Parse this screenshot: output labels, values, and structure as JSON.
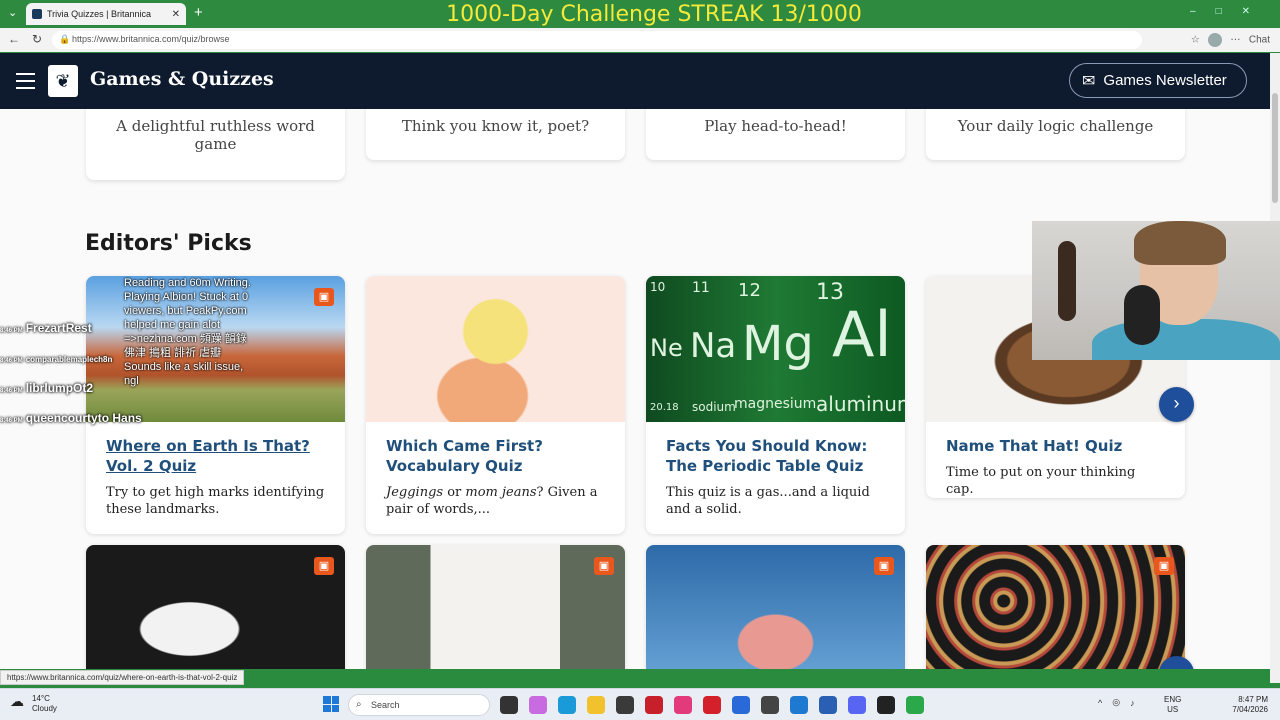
{
  "browser": {
    "tab_title": "Trivia Quizzes | Britannica",
    "url": "https://www.britannica.com/quiz/browse",
    "chat_label": "Chat",
    "status_url": "https://www.britannica.com/quiz/where-on-earth-is-that-vol-2-quiz"
  },
  "overlay": {
    "streak": "1000-Day Challenge STREAK 13/1000",
    "stream_text": "Reading and 60m Writing. Playing Albion! Stuck at 0 viewers, but PeakPy.com helped me gain alot =>nezhna.com 頻躁 韻錄 佛津 搗粗 誹祈 虐瓣 Sounds like a skill issue, ngl",
    "chat": [
      {
        "time": "8:46 PM",
        "user": "FrezartRest"
      },
      {
        "time": "8:46 PM",
        "user": "comparablemaplech8n"
      },
      {
        "time": "8:46 PM",
        "user": "librlumpOt2"
      },
      {
        "time": "8:46 PM",
        "user": "queencourtyto Hans"
      }
    ]
  },
  "header": {
    "site_title": "Games & Quizzes",
    "newsletter_label": "Games Newsletter"
  },
  "top_cards": [
    {
      "text": "A delightful ruthless word game"
    },
    {
      "text": "Think you know it, poet?"
    },
    {
      "text": "Play head-to-head!"
    },
    {
      "text": "Your daily logic challenge"
    }
  ],
  "editors_picks": {
    "title": "Editors' Picks",
    "cards": [
      {
        "title": "Where on Earth Is That? Vol. 2 Quiz",
        "desc": "Try to get high marks identifying these landmarks."
      },
      {
        "title": "Which Came First? Vocabulary Quiz",
        "desc_italic_1": "Jeggings",
        "desc_mid": " or ",
        "desc_italic_2": "mom jeans",
        "desc_rest": "? Given a pair of words,..."
      },
      {
        "title": "Facts You Should Know: The Periodic Table Quiz",
        "desc": "This quiz is a gas...and a liquid and a solid."
      },
      {
        "title": "Name That Hat! Quiz",
        "desc": "Time to put on your thinking cap."
      }
    ],
    "elements": [
      "Ne",
      "Na",
      "Mg",
      "Al"
    ],
    "element_sub": [
      "20.18",
      "sodium",
      "magnesium",
      "aluminum"
    ],
    "element_num": [
      "10",
      "11",
      "12",
      "13"
    ]
  },
  "taskbar": {
    "temp": "14°C",
    "weather": "Cloudy",
    "search_placeholder": "Search",
    "lang1": "ENG",
    "lang2": "US",
    "time": "8:47 PM",
    "date": "7/04/2026"
  },
  "colors": {
    "header_bg": "#0e1a2e",
    "title_link": "#1f4f7a",
    "accent_icon": "#e8581c",
    "next_button": "#1f4f9a"
  }
}
